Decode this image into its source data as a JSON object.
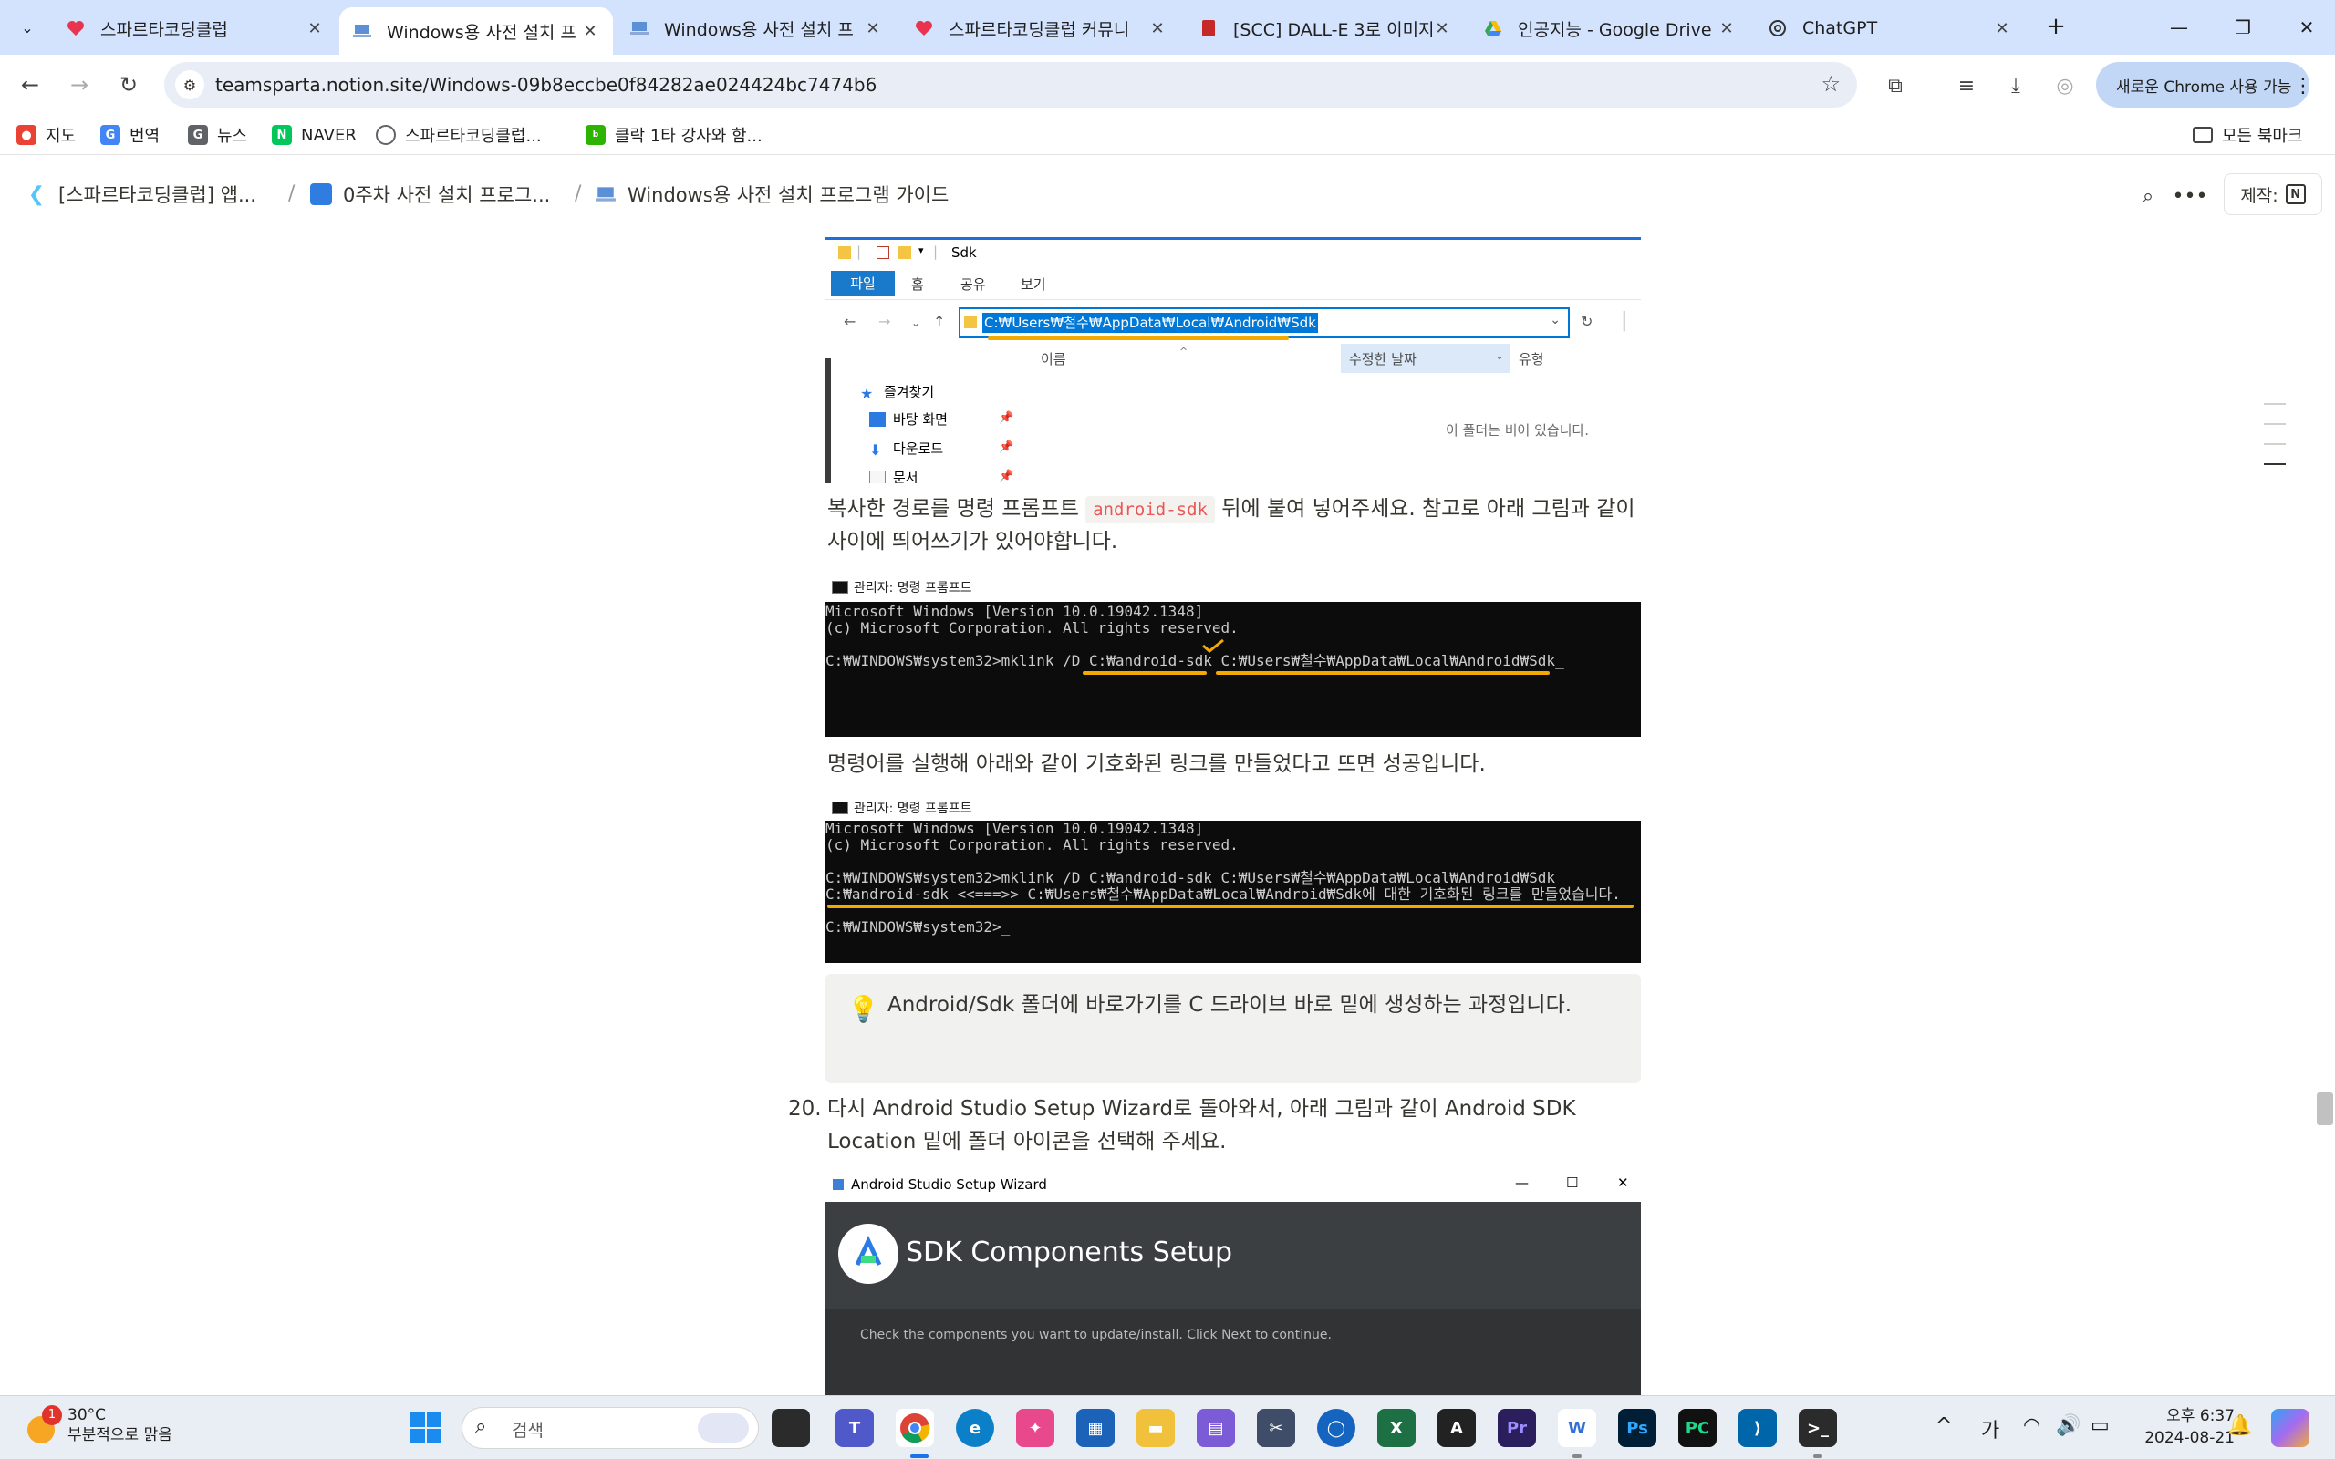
{
  "browser": {
    "tabs": [
      {
        "title": "스파르타코딩클럽",
        "icon": "heart-icon",
        "active": false
      },
      {
        "title": "Windows용 사전 설치 프",
        "icon": "laptop-icon",
        "active": true
      },
      {
        "title": "Windows용 사전 설치 프",
        "icon": "laptop-icon",
        "active": false
      },
      {
        "title": "스파르타코딩클럽 커뮤니",
        "icon": "heart-icon",
        "active": false
      },
      {
        "title": "[SCC] DALL-E 3로 이미지",
        "icon": "book-icon",
        "active": false
      },
      {
        "title": "인공지능 - Google Drive",
        "icon": "drive-icon",
        "active": false
      },
      {
        "title": "ChatGPT",
        "icon": "openai-icon",
        "active": false
      }
    ],
    "close_glyph": "✕",
    "new_tab_glyph": "+",
    "url": "teamsparta.notion.site/Windows-09b8eccbe0f84282ae024424bc7474b6",
    "chrome_update_label": "새로운 Chrome 사용 가능",
    "bookmarks": [
      {
        "label": "지도",
        "icon": "maps-icon",
        "color": "#ea4335"
      },
      {
        "label": "번역",
        "icon": "translate-icon",
        "color": "#4285f4"
      },
      {
        "label": "뉴스",
        "icon": "news-icon",
        "color": "#5f6368"
      },
      {
        "label": "NAVER",
        "icon": "naver-icon",
        "color": "#03c75a"
      },
      {
        "label": "스파르타코딩클럽...",
        "icon": "globe-icon",
        "color": "#5f6368"
      },
      {
        "label": "클락 1타 강사와 함...",
        "icon": "blog-icon",
        "color": "#2db400"
      }
    ],
    "all_bookmarks_label": "모든 북마크"
  },
  "notion": {
    "breadcrumbs": [
      {
        "label": "[스파르타코딩클럽] 앱...",
        "icon": "flutter-icon"
      },
      {
        "label": "0주차 사전 설치 프로그...",
        "icon": "book-icon"
      },
      {
        "label": "Windows용 사전 설치 프로그램 가이드",
        "icon": "laptop-icon"
      }
    ],
    "crumb_separator": "/",
    "made_by_label": "제작:",
    "notion_logo": "N"
  },
  "explorer": {
    "folder_name": "Sdk",
    "ribbon_tabs": [
      "파일",
      "홈",
      "공유",
      "보기"
    ],
    "path": "C:₩Users₩철수₩AppData₩Local₩Android₩Sdk",
    "columns": [
      "이름",
      "수정한 날짜",
      "유형"
    ],
    "tree": [
      {
        "label": "즐겨찾기",
        "icon": "star-icon"
      },
      {
        "label": "바탕 화면",
        "icon": "desktop-icon"
      },
      {
        "label": "다운로드",
        "icon": "download-icon"
      },
      {
        "label": "문서",
        "icon": "document-icon"
      }
    ],
    "empty_text": "이 폴더는 비어 있습니다."
  },
  "content": {
    "para1_a": "복사한 경로를 명령 프롬프트 ",
    "para1_code": "android-sdk",
    "para1_b": " 뒤에 붙여 넣어주세요. 참고로 아래 그림과 같이 사이에 띄어쓰기가 있어야합니다.",
    "cmd_title": "관리자: 명령 프롬프트",
    "cmd1_lines": [
      "Microsoft Windows [Version 10.0.19042.1348]",
      "(c) Microsoft Corporation. All rights reserved.",
      "",
      "C:₩WINDOWS₩system32>mklink /D C:₩android-sdk C:₩Users₩철수₩AppData₩Local₩Android₩Sdk_"
    ],
    "para2": "명령어를 실행해 아래와 같이 기호화된 링크를 만들었다고 뜨면 성공입니다.",
    "cmd2_lines": [
      "Microsoft Windows [Version 10.0.19042.1348]",
      "(c) Microsoft Corporation. All rights reserved.",
      "",
      "C:₩WINDOWS₩system32>mklink /D C:₩android-sdk C:₩Users₩철수₩AppData₩Local₩Android₩Sdk",
      "C:₩android-sdk <<===>> C:₩Users₩철수₩AppData₩Local₩Android₩Sdk에 대한 기호화된 링크를 만들었습니다.",
      "",
      "C:₩WINDOWS₩system32>_"
    ],
    "callout_text": "Android/Sdk 폴더에 바로가기를 C 드라이브 바로 밑에 생성하는 과정입니다.",
    "list_number": "20.",
    "list_text": "다시 Android Studio Setup Wizard로 돌아와서, 아래 그림과 같이 Android SDK Location 밑에 폴더 아이콘을 선택해 주세요.",
    "wizard_window_title": "Android Studio Setup Wizard",
    "wizard_heading": "SDK Components Setup",
    "wizard_sub": "Check the components you want to update/install. Click Next to continue."
  },
  "taskbar": {
    "weather_temp": "30°C",
    "weather_desc": "부분적으로 맑음",
    "weather_badge": "1",
    "search_placeholder": "검색",
    "ime": "가",
    "time": "오후 6:37",
    "date": "2024-08-21"
  }
}
